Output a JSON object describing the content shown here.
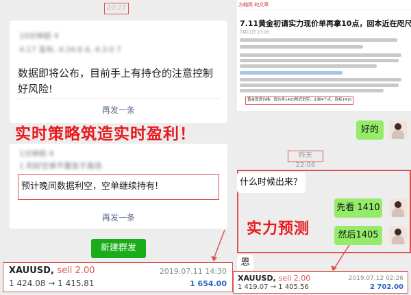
{
  "left": {
    "timestamp": "20:27",
    "card1": {
      "blur_line1": "10分钟前 4",
      "blur_line2": "4:17 发布, 4:34:6 6, 4:3:0 7",
      "message": "数据即将公布，目前手上有持仓的注意控制好风险!",
      "resend": "再发一条"
    },
    "headline": "实时策略筑造实时盈利！",
    "card2": {
      "blur_line1": "1分钟前 4",
      "blur_line2": "1 利好空单不要急于离场",
      "boxed_message": "预计晚间数据利空，空单继续持有!",
      "resend": "再发一条"
    },
    "new_group_button": "新建群发",
    "ticket": {
      "symbol": "XAUUSD,",
      "side": "sell 2.00",
      "date": "2019.07.11 14:30",
      "prices": "1 424.08 → 1 415.81",
      "profit": "1 654.00"
    }
  },
  "right": {
    "article": {
      "header": "方翰简 的文章",
      "title": "7.11黄金初请实力现价单再拿10点，回本近在咫尺！",
      "meta": "7月11日 23:06",
      "highlight": "黄金现货价格：现价多1420附近进空，止损4个点，目标1410"
    },
    "reply1": "好的",
    "timestamp": "昨天 22:06",
    "question": "什么时候出来？",
    "answer1": "先看 1410",
    "answer2": "然后1405",
    "headline": "实力预测",
    "reply2": "恩",
    "ticket": {
      "symbol": "XAUUSD,",
      "side": "sell 2.00",
      "date": "2019.07.12 02:26",
      "prices": "1 419.07 → 1 405.56",
      "profit": "2 702.00"
    }
  },
  "colors": {
    "accent_red": "#e8191c",
    "bubble_green": "#95ec69",
    "button_green": "#1aad19",
    "profit_blue": "#2b63c6"
  }
}
